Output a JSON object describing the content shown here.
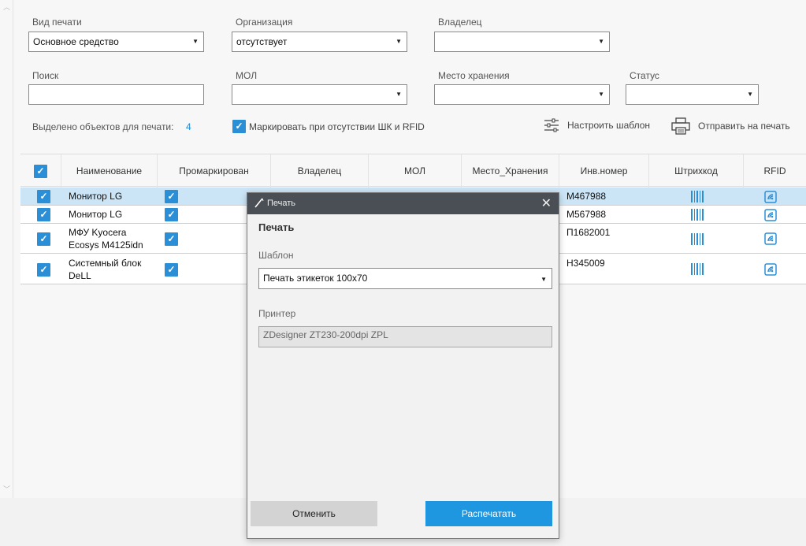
{
  "filters": {
    "print_type": {
      "label": "Вид печати",
      "value": "Основное средство"
    },
    "organization": {
      "label": "Организация",
      "value": "отсутствует"
    },
    "owner": {
      "label": "Владелец",
      "value": ""
    },
    "search": {
      "label": "Поиск",
      "value": ""
    },
    "mol": {
      "label": "МОЛ",
      "value": ""
    },
    "storage": {
      "label": "Место хранения",
      "value": ""
    },
    "status": {
      "label": "Статус",
      "value": ""
    }
  },
  "selection": {
    "label": "Выделено объектов для печати:",
    "count": "4",
    "mark_checkbox_label": "Маркировать при отсутствии ШК и RFID"
  },
  "toolbar": {
    "configure_label": "Настроить шаблон",
    "send_label": "Отправить на печать"
  },
  "table": {
    "columns": [
      "Наименование",
      "Промаркирован",
      "Владелец",
      "МОЛ",
      "Место_Хранения",
      "Инв.номер",
      "Штрихкод",
      "RFID"
    ],
    "rows": [
      {
        "name": "Монитор LG",
        "name2": "",
        "inv": "M467988"
      },
      {
        "name": "Монитор LG",
        "name2": "",
        "inv": "M567988"
      },
      {
        "name": "МФУ Kyocera",
        "name2": "Ecosys M4125idn",
        "inv": "П1682001"
      },
      {
        "name": "Системный блок",
        "name2": "DeLL",
        "inv": "Н345009"
      }
    ]
  },
  "dialog": {
    "window_title": "Печать",
    "heading": "Печать",
    "template_label": "Шаблон",
    "template_value": "Печать этикеток 100х70",
    "printer_label": "Принтер",
    "printer_value": "ZDesigner ZT230-200dpi ZPL",
    "cancel_label": "Отменить",
    "print_label": "Распечатать"
  },
  "colors": {
    "accent": "#2b8fd8",
    "selected_row": "#cce5f6",
    "titlebar": "#4a4f55",
    "print_button": "#1e96e0"
  }
}
